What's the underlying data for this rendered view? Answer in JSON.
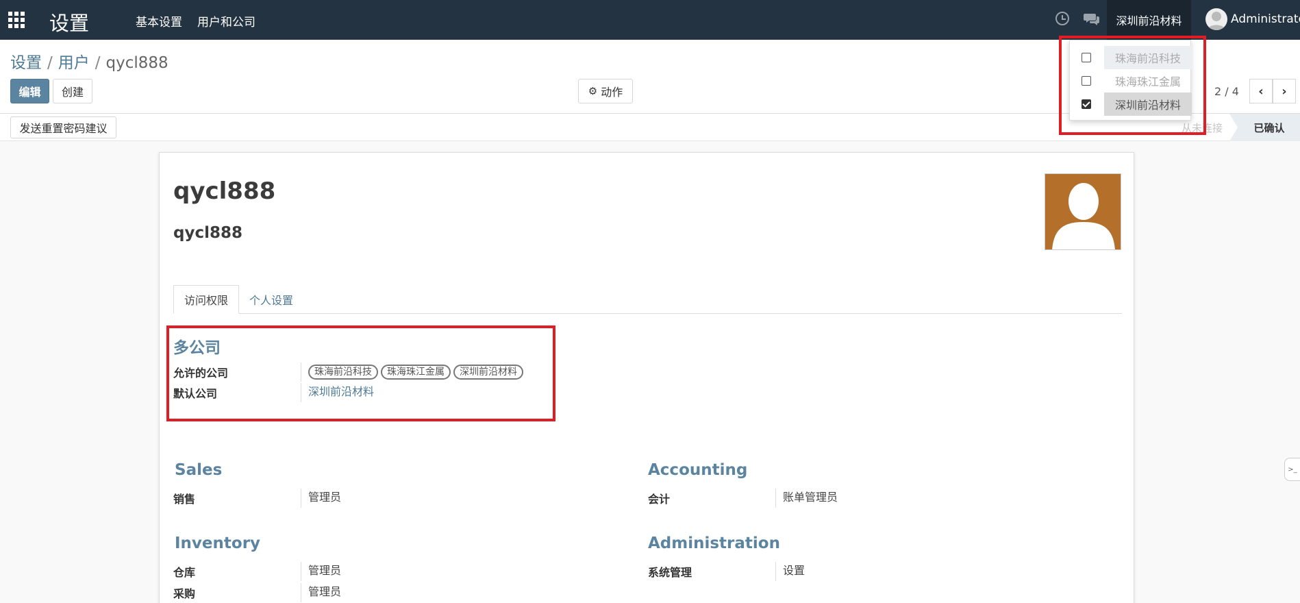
{
  "navbar": {
    "app_title": "设置",
    "menu": [
      "基本设置",
      "用户和公司"
    ],
    "current_company": "深圳前沿材料",
    "user_name": "Administrator"
  },
  "breadcrumb": {
    "items": [
      "设置",
      "用户",
      "qycl888"
    ]
  },
  "toolbar": {
    "edit_label": "编辑",
    "create_label": "创建",
    "action_label": "动作",
    "pager": "2 / 4",
    "reset_password_label": "发送重置密码建议"
  },
  "status": {
    "stages": [
      "从未连接",
      "已确认"
    ]
  },
  "company_dropdown": {
    "items": [
      {
        "label": "珠海前沿科技",
        "checked": false
      },
      {
        "label": "珠海珠江金属",
        "checked": false
      },
      {
        "label": "深圳前沿材料",
        "checked": true
      }
    ]
  },
  "form": {
    "name": "qycl888",
    "login": "qycl888",
    "tabs": [
      "访问权限",
      "个人设置"
    ],
    "multi_company": {
      "title": "多公司",
      "allowed_label": "允许的公司",
      "allowed_tags": [
        "珠海前沿科技",
        "珠海珠江金属",
        "深圳前沿材料"
      ],
      "default_label": "默认公司",
      "default_value": "深圳前沿材料"
    },
    "sales": {
      "title": "Sales",
      "fields": [
        {
          "label": "销售",
          "value": "管理员"
        }
      ]
    },
    "accounting": {
      "title": "Accounting",
      "fields": [
        {
          "label": "会计",
          "value": "账单管理员"
        }
      ]
    },
    "inventory": {
      "title": "Inventory",
      "fields": [
        {
          "label": "仓库",
          "value": "管理员"
        },
        {
          "label": "采购",
          "value": "管理员"
        }
      ]
    },
    "administration": {
      "title": "Administration",
      "fields": [
        {
          "label": "系统管理",
          "value": "设置"
        }
      ]
    }
  },
  "colors": {
    "navbar": "#243342",
    "accent": "#5b84a0",
    "highlight": "#e01c24",
    "avatar_bg": "#b4702a"
  }
}
